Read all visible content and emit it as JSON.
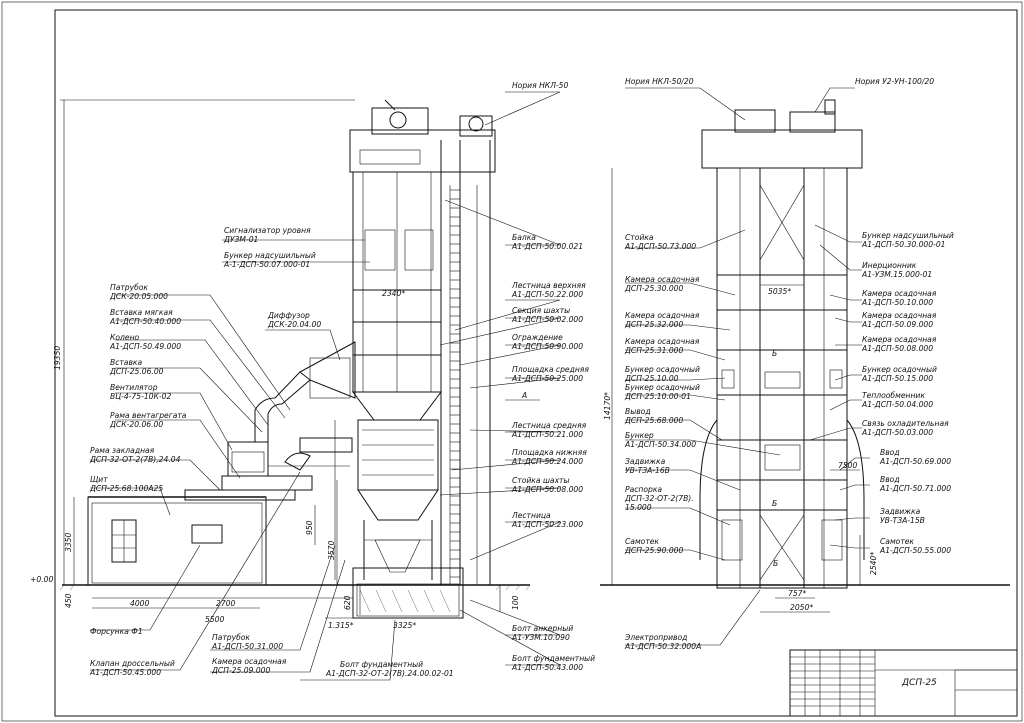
{
  "left_view": {
    "callouts_left": [
      {
        "id": "ls1",
        "lines": [
          "Сигнализатор уровня",
          "ДУЗМ-01"
        ]
      },
      {
        "id": "ls2",
        "lines": [
          "Бункер надсушильный",
          "А-1-ДСП-50.07.000-01"
        ]
      },
      {
        "id": "l1",
        "lines": [
          "Патрубок",
          "ДСК-20.05.000"
        ]
      },
      {
        "id": "l2",
        "lines": [
          "Вставка мягкая",
          "А1-ДСП-50.40.000"
        ]
      },
      {
        "id": "l3",
        "lines": [
          "Колено",
          "А1-ДСП-50.49.000"
        ]
      },
      {
        "id": "l4",
        "lines": [
          "Вставка",
          "ДСП-25.06.00"
        ]
      },
      {
        "id": "l5",
        "lines": [
          "Вентилятор",
          "ВЦ-4-75-10К-02"
        ]
      },
      {
        "id": "l6",
        "lines": [
          "Рама вентагрегата",
          "ДСК-20.06.00"
        ]
      },
      {
        "id": "l7",
        "lines": [
          "Рама закладная",
          "ДСП-32-ОТ-2(7В),24.04"
        ]
      },
      {
        "id": "l8",
        "lines": [
          "Щит",
          "ДСП-25.68.100А25"
        ]
      },
      {
        "id": "l9",
        "lines": [
          "Форсунка Ф1"
        ]
      },
      {
        "id": "l10",
        "lines": [
          "Клапан дроссельный",
          "А1-ДСП-50.45.000"
        ]
      },
      {
        "id": "l11",
        "lines": [
          "Патрубок",
          "А1-ДСП-50.31.000"
        ]
      },
      {
        "id": "l12",
        "lines": [
          "Камера осадочная",
          "ДСП-25.09.000"
        ]
      },
      {
        "id": "l13",
        "lines": [
          "Диффузор",
          "ДСК-20.04.00"
        ]
      },
      {
        "id": "l14",
        "lines": [
          "Болт фундаментный",
          "А1-ДСП-32-ОТ-2(7В).24.00.02-01"
        ]
      }
    ],
    "callouts_right": [
      {
        "id": "r0",
        "lines": [
          "Нория НКЛ-50"
        ]
      },
      {
        "id": "r1",
        "lines": [
          "Балка",
          "А1-ДСП-50.00.021"
        ]
      },
      {
        "id": "r2",
        "lines": [
          "Лестница верхняя",
          "А1-ДСП-50.22.000"
        ]
      },
      {
        "id": "r3",
        "lines": [
          "Секция шахты",
          "А1-ДСП-50.02.000"
        ]
      },
      {
        "id": "r4",
        "lines": [
          "Ограждение",
          "А1-ДСП-50.90.000"
        ]
      },
      {
        "id": "r5",
        "lines": [
          "Площадка средняя",
          "А1-ДСП-50.25.000"
        ]
      },
      {
        "id": "r6",
        "lines": [
          "Лестница средняя",
          "А1-ДСП-50.21.000"
        ]
      },
      {
        "id": "r7",
        "lines": [
          "Площадка нижняя",
          "А1-ДСП-50.24.000"
        ]
      },
      {
        "id": "r8",
        "lines": [
          "Стойка шахты",
          "А1-ДСП-50.08.000"
        ]
      },
      {
        "id": "r9",
        "lines": [
          "Лестница",
          "А1-ДСП-50.23.000"
        ]
      },
      {
        "id": "r10",
        "lines": [
          "Болт анкерный",
          "А1-УЗМ.10.090"
        ]
      },
      {
        "id": "r11",
        "lines": [
          "Болт фундаментный",
          "А1-ДСП-50.43.000"
        ]
      }
    ],
    "dims": {
      "d19350": "19350",
      "d3350": "3350",
      "dzero": "+0.00",
      "d450": "450",
      "d4000": "4000",
      "d2700": "2700",
      "d5500": "5500",
      "d1315": "1.315*",
      "d3325": "3325*",
      "d2340": "2340*",
      "d3570": "3570",
      "d950": "950",
      "d620": "620",
      "d100": "100",
      "dA": "А"
    }
  },
  "right_view": {
    "callouts_left": [
      {
        "id": "q0",
        "lines": [
          "Нория НКЛ-50/20"
        ]
      },
      {
        "id": "q1",
        "lines": [
          "Стойка",
          "А1-ДСП-50.73.000"
        ]
      },
      {
        "id": "q2",
        "lines": [
          "Камера осадочная",
          "ДСП-25.30.000"
        ]
      },
      {
        "id": "q3",
        "lines": [
          "Камера осадочная",
          "ДСП-25.32.000"
        ]
      },
      {
        "id": "q4",
        "lines": [
          "Камера осадочная",
          "ДСП-25.31.000"
        ]
      },
      {
        "id": "q5",
        "lines": [
          "Бункер осадочный",
          "ДСП-25.10.00"
        ]
      },
      {
        "id": "q6",
        "lines": [
          "Бункер осадочный",
          "ДСП-25.10.00-01"
        ]
      },
      {
        "id": "q7",
        "lines": [
          "Вывод",
          "ДСП-25.68.000"
        ]
      },
      {
        "id": "q8",
        "lines": [
          "Бункер",
          "А1-ДСП-50.34.000"
        ]
      },
      {
        "id": "q9",
        "lines": [
          "Задвижка",
          "УВ-ТЗА-16В"
        ]
      },
      {
        "id": "q10",
        "lines": [
          "Распорка",
          "ДСП-32-ОТ-2(7В).",
          "15.000"
        ]
      },
      {
        "id": "q11",
        "lines": [
          "Самотек",
          "ДСП-25.90.000"
        ]
      },
      {
        "id": "q12",
        "lines": [
          "Электропривод",
          "А1-ДСП-50.32.000А"
        ]
      }
    ],
    "callouts_right": [
      {
        "id": "p0",
        "lines": [
          "Нория У2-УН-100/20"
        ]
      },
      {
        "id": "p1",
        "lines": [
          "Бункер надсушильный",
          "А1-ДСП-50.30.000-01"
        ]
      },
      {
        "id": "p2",
        "lines": [
          "Инерционник",
          "А1-УЗМ.15.000-01"
        ]
      },
      {
        "id": "p3",
        "lines": [
          "Камера осадочная",
          "А1-ДСП-50.10.000"
        ]
      },
      {
        "id": "p4",
        "lines": [
          "Камера осадочная",
          "А1-ДСП-50.09.000"
        ]
      },
      {
        "id": "p5",
        "lines": [
          "Камера осадочная",
          "А1-ДСП-50.08.000"
        ]
      },
      {
        "id": "p6",
        "lines": [
          "Бункер осадочный",
          "А1-ДСП-50.15.000"
        ]
      },
      {
        "id": "p7",
        "lines": [
          "Теплообменник",
          "А1-ДСП-50.04.000"
        ]
      },
      {
        "id": "p8",
        "lines": [
          "Связь охладительная",
          "А1-ДСП-50.03.000"
        ]
      },
      {
        "id": "p9",
        "lines": [
          "Ввод",
          "А1-ДСП-50.69.000"
        ]
      },
      {
        "id": "p10",
        "lines": [
          "Ввод",
          "А1-ДСП-50.71.000"
        ]
      },
      {
        "id": "p11",
        "lines": [
          "Задвижка",
          "УВ-ТЗА-15В"
        ]
      },
      {
        "id": "p12",
        "lines": [
          "Самотек",
          "А1-ДСП-50.55.000"
        ]
      }
    ],
    "dims": {
      "d14170": "14170*",
      "d5035": "5035*",
      "d7500": "7500",
      "d757": "757*",
      "d2050": "2050*",
      "d2540": "2540*",
      "dB1": "Б",
      "dB2": "Б",
      "dB3": "Б"
    }
  },
  "title_block": {
    "designation": "ДСП-25"
  }
}
